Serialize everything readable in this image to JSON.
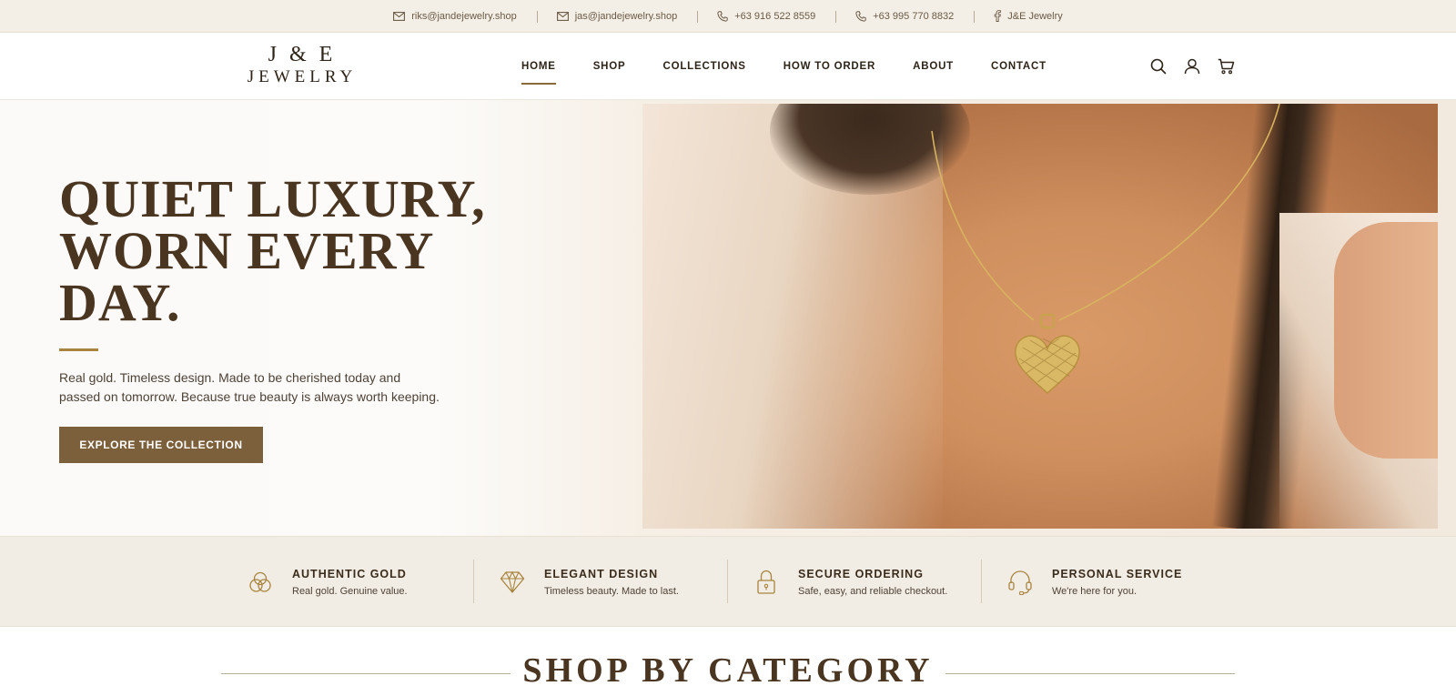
{
  "topbar": {
    "contacts": [
      {
        "icon": "mail-icon",
        "text": "riks@jandejewelry.shop"
      },
      {
        "icon": "mail-icon",
        "text": "jas@jandejewelry.shop"
      },
      {
        "icon": "phone-icon",
        "text": "+63 916 522 8559"
      },
      {
        "icon": "phone-icon",
        "text": "+63 995 770 8832"
      },
      {
        "icon": "facebook-icon",
        "text": "J&E Jewelry"
      }
    ]
  },
  "header": {
    "logo_line1": "J & E",
    "logo_line2": "JEWELRY",
    "nav": [
      {
        "label": "HOME",
        "active": true
      },
      {
        "label": "SHOP"
      },
      {
        "label": "COLLECTIONS"
      },
      {
        "label": "HOW TO ORDER"
      },
      {
        "label": "ABOUT"
      },
      {
        "label": "CONTACT"
      }
    ],
    "icons": [
      "search-icon",
      "user-icon",
      "cart-icon"
    ]
  },
  "hero": {
    "title_lines": [
      "QUIET LUXURY,",
      "WORN EVERY",
      "DAY."
    ],
    "text": "Real gold. Timeless design. Made to be cherished today and passed on tomorrow. Because true beauty is always worth keeping.",
    "button": "EXPLORE THE COLLECTION"
  },
  "features": [
    {
      "icon": "rings-icon",
      "title": "AUTHENTIC GOLD",
      "subtitle": "Real gold. Genuine value."
    },
    {
      "icon": "diamond-icon",
      "title": "ELEGANT DESIGN",
      "subtitle": "Timeless beauty. Made to last."
    },
    {
      "icon": "lock-icon",
      "title": "SECURE ORDERING",
      "subtitle": "Safe, easy, and reliable checkout."
    },
    {
      "icon": "headset-icon",
      "title": "PERSONAL SERVICE",
      "subtitle": "We're here for you."
    }
  ],
  "section": {
    "title": "SHOP BY CATEGORY"
  },
  "colors": {
    "accent": "#7c5f3b",
    "gold": "#a8843f",
    "text": "#4a3520",
    "strip": "#f2ede4"
  }
}
